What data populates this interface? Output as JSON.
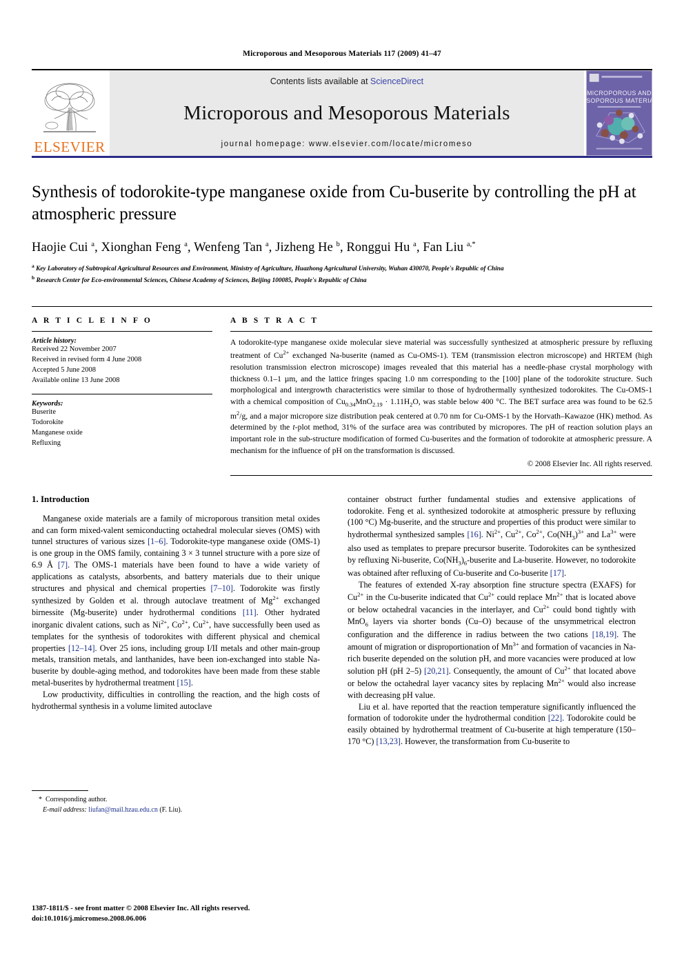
{
  "running_head": "Microporous and Mesoporous Materials 117 (2009) 41–47",
  "masthead": {
    "publisher_name": "ELSEVIER",
    "contents_prefix": "Contents lists available at ",
    "contents_link": "ScienceDirect",
    "journal_title": "Microporous and Mesoporous Materials",
    "homepage": "journal homepage: www.elsevier.com/locate/micromeso",
    "cover_title_line1": "MICROPOROUS AND",
    "cover_title_line2": "MESOPOROUS MATERIALS",
    "accent_orange": "#E9711C",
    "link_blue": "#3a43a8",
    "rule_blue": "#2c2c86",
    "cover_purple": "#6b5fa6"
  },
  "article": {
    "title": "Synthesis of todorokite-type manganese oxide from Cu-buserite by controlling the pH at atmospheric pressure",
    "authors_html": "Haojie Cui <sup>a</sup>, Xionghan Feng <sup>a</sup>, Wenfeng Tan <sup>a</sup>, Jizheng He <sup>b</sup>, Ronggui Hu <sup>a</sup>, Fan Liu <sup>a,</sup><sup>*</sup>",
    "affiliation_a": "Key Laboratory of Subtropical Agricultural Resources and Environment, Ministry of Agriculture, Huazhong Agricultural University, Wuhan 430070, People's Republic of China",
    "affiliation_b": "Research Center for Eco-environmental Sciences, Chinese Academy of Sciences, Beijing 100085, People's Republic of China"
  },
  "article_info": {
    "heading": "A R T I C L E    I N F O",
    "history_label": "Article history:",
    "history": [
      "Received 22 November 2007",
      "Received in revised form 4 June 2008",
      "Accepted 5 June 2008",
      "Available online 13 June 2008"
    ],
    "keywords_label": "Keywords:",
    "keywords": [
      "Buserite",
      "Todorokite",
      "Manganese oxide",
      "Refluxing"
    ]
  },
  "abstract": {
    "heading": "A B S T R A C T",
    "text_html": "A todorokite-type manganese oxide molecular sieve material was successfully synthesized at atmospheric pressure by refluxing treatment of Cu<sup>2+</sup> exchanged Na-buserite (named as Cu-OMS-1). TEM (transmission electron microscope) and HRTEM (high resolution transmission electron microscope) images revealed that this material has a needle-phase crystal morphology with thickness 0.1–1 &#181;m, and the lattice fringes spacing 1.0 nm corresponding to the [100] plane of the todorokite structure. Such morphological and intergrowth characteristics were similar to those of hydrothermally synthesized todorokites. The Cu-OMS-1 with a chemical composition of Cu<sub>0.34</sub>MnO<sub>2.19</sub> &#183; 1.11H<sub>2</sub>O, was stable below 400 &#176;C. The BET surface area was found to be 62.5 m<sup>2</sup>/g, and a major micropore size distribution peak centered at 0.70 nm for Cu-OMS-1 by the Horvath–Kawazoe (HK) method. As determined by the <i>t</i>-plot method, 31% of the surface area was contributed by micropores. The pH of reaction solution plays an important role in the sub-structure modification of formed Cu-buserites and the formation of todorokite at atmospheric pressure. A mechanism for the influence of pH on the transformation is discussed.",
    "copyright": "© 2008 Elsevier Inc. All rights reserved."
  },
  "introduction": {
    "heading": "1. Introduction",
    "left_paragraphs_html": [
      "Manganese oxide materials are a family of microporous transition metal oxides and can form mixed-valent semiconducting octahedral molecular sieves (OMS) with tunnel structures of various sizes <span class=\"ref\">[1–6]</span>. Todorokite-type manganese oxide (OMS-1) is one group in the OMS family, containing 3 &#215; 3 tunnel structure with a pore size of 6.9 &#197; <span class=\"ref\">[7]</span>. The OMS-1 materials have been found to have a wide variety of applications as catalysts, absorbents, and battery materials due to their unique structures and physical and chemical properties <span class=\"ref\">[7–10]</span>. Todorokite was firstly synthesized by Golden et al. through autoclave treatment of Mg<sup>2+</sup> exchanged birnessite (Mg-buserite) under hydrothermal conditions <span class=\"ref\">[11]</span>. Other hydrated inorganic divalent cations, such as Ni<sup>2+</sup>, Co<sup>2+</sup>, Cu<sup>2+</sup>, have successfully been used as templates for the synthesis of todorokites with different physical and chemical properties <span class=\"ref\">[12–14]</span>. Over 25 ions, including group I/II metals and other main-group metals, transition metals, and lanthanides, have been ion-exchanged into stable Na-buserite by double-aging method, and todorokites have been made from these stable metal-buserites by hydrothermal treatment <span class=\"ref\">[15]</span>.",
      "Low productivity, difficulties in controlling the reaction, and the high costs of hydrothermal synthesis in a volume limited autoclave"
    ],
    "right_paragraphs_html": [
      "container obstruct further fundamental studies and extensive applications of todorokite. Feng et al. synthesized todorokite at atmospheric pressure by refluxing (100 &#176;C) Mg-buserite, and the structure and properties of this product were similar to hydrothermal synthesized samples <span class=\"ref\">[16]</span>. Ni<sup>2+</sup>, Cu<sup>2+</sup>, Co<sup>2+</sup>, Co(NH<sub>3</sub>)<sup>3+</sup> and La<sup>3+</sup> were also used as templates to prepare precursor buserite. Todorokites can be synthesized by refluxing Ni-buserite, Co(NH<sub>3</sub>)<sub>6</sub>-buserite and La-buserite. However, no todorokite was obtained after refluxing of Cu-buserite and Co-buserite <span class=\"ref\">[17]</span>.",
      "The features of extended X-ray absorption fine structure spectra (EXAFS) for Cu<sup>2+</sup> in the Cu-buserite indicated that Cu<sup>2+</sup> could replace Mn<sup>2+</sup> that is located above or below octahedral vacancies in the interlayer, and Cu<sup>2+</sup> could bond tightly with MnO<sub>6</sub> layers via shorter bonds (Cu&#8211;O) because of the unsymmetrical electron configuration and the difference in radius between the two cations <span class=\"ref\">[18,19]</span>. The amount of migration or disproportionation of Mn<sup>3+</sup> and formation of vacancies in Na-rich buserite depended on the solution pH, and more vacancies were produced at low solution pH (pH 2–5) <span class=\"ref\">[20,21]</span>. Consequently, the amount of Cu<sup>2+</sup> that located above or below the octahedral layer vacancy sites by replacing Mn<sup>2+</sup> would also increase with decreasing pH value.",
      "Liu et al. have reported that the reaction temperature significantly influenced the formation of todorokite under the hydrothermal condition <span class=\"ref\">[22]</span>. Todorokite could be easily obtained by hydrothermal treatment of Cu-buserite at high temperature (150–170 &#176;C) <span class=\"ref\">[13,23]</span>. However, the transformation from Cu-buserite to"
    ]
  },
  "footnote": {
    "corresponding_star": "*",
    "corresponding_text": "Corresponding author.",
    "email_label": "E-mail address:",
    "email": "liufan@mail.hzau.edu.cn",
    "email_suffix": "(F. Liu)."
  },
  "imprint": {
    "line1": "1387-1811/$ - see front matter © 2008 Elsevier Inc. All rights reserved.",
    "line2": "doi:10.1016/j.micromeso.2008.06.006"
  }
}
